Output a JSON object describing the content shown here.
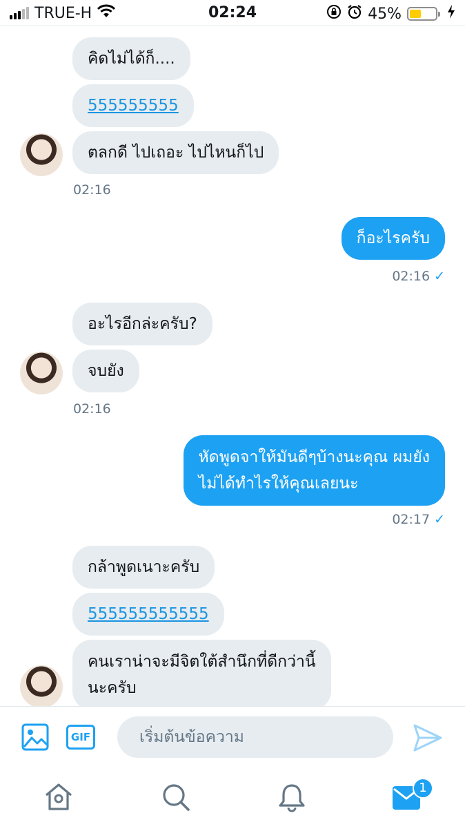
{
  "status_bar": {
    "carrier": "TRUE-H",
    "time": "02:24",
    "battery_percent": "45%",
    "battery_level": 0.45,
    "icons": [
      "signal-icon",
      "wifi-icon",
      "rotation-lock-icon",
      "alarm-icon",
      "battery-icon",
      "charging-icon"
    ]
  },
  "conversation": {
    "groups": [
      {
        "side": "in",
        "messages": [
          {
            "text": "คิดไม่ได้ก็...."
          },
          {
            "text": "555555555",
            "link": true
          },
          {
            "text": "ตลกดี ไปเถอะ ไปไหนก็ไป"
          }
        ],
        "time": "02:16"
      },
      {
        "side": "out",
        "messages": [
          {
            "text": "ก็อะไรครับ"
          }
        ],
        "time": "02:16"
      },
      {
        "side": "in",
        "messages": [
          {
            "text": "อะไรอีกล่ะครับ?"
          },
          {
            "text": "จบยัง"
          }
        ],
        "time": "02:16"
      },
      {
        "side": "out",
        "messages": [
          {
            "text": "หัดพูดจาให้มันดีๆบ้างนะคุณ ผมยัง\nไม่ได้ทำไรให้คุณเลยนะ"
          }
        ],
        "time": "02:17"
      },
      {
        "side": "in",
        "messages": [
          {
            "text": "กล้าพูดเนาะครับ"
          },
          {
            "text": "555555555555",
            "link": true
          },
          {
            "text": "คนเราน่าจะมีจิตใต้สำนึกที่ดีกว่านี้\nนะครับ"
          }
        ]
      }
    ]
  },
  "composer": {
    "placeholder": "เริ่มต้นข้อความ",
    "gif_label": "GIF"
  },
  "tabbar": {
    "items": [
      "home-icon",
      "search-icon",
      "notifications-icon",
      "messages-icon"
    ],
    "messages_badge": "1"
  },
  "colors": {
    "accent": "#1da1f2",
    "incoming_bubble": "#e6ecf0",
    "timestamp": "#657786"
  }
}
